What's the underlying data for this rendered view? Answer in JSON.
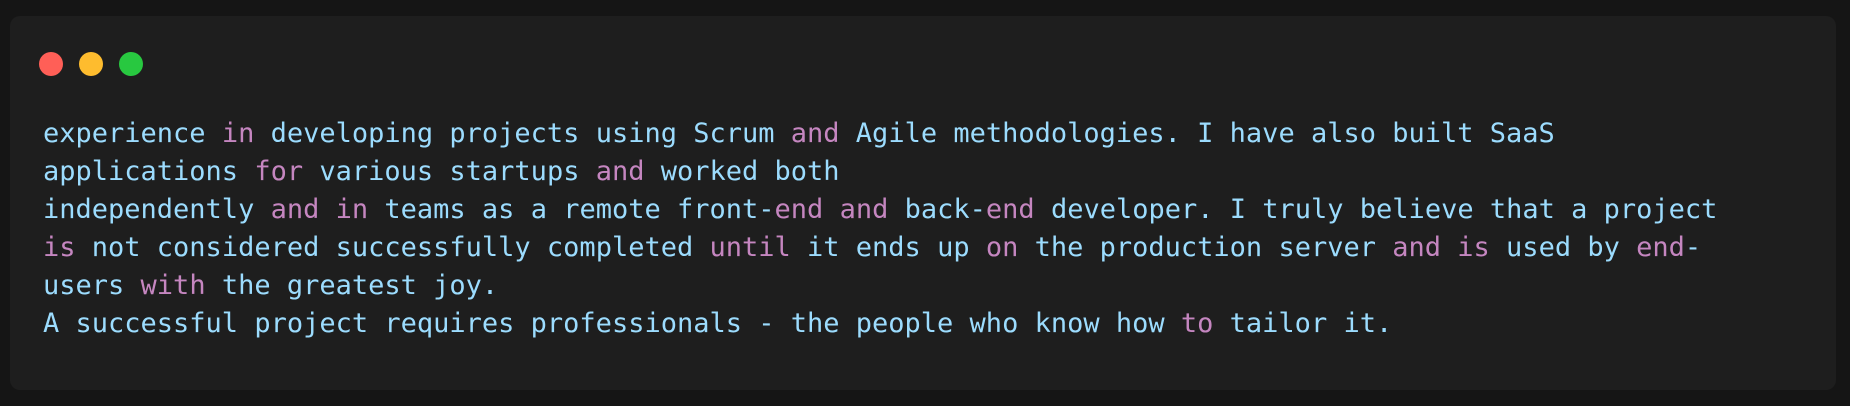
{
  "window": {
    "controls": [
      {
        "name": "close",
        "color": "#ff5f57"
      },
      {
        "name": "minimize",
        "color": "#febc2e"
      },
      {
        "name": "maximize",
        "color": "#28c840"
      }
    ]
  },
  "colors": {
    "text": "#9cdcfe",
    "keyword": "#c586c0",
    "background": "#1e1e1e"
  },
  "code": {
    "lines": [
      [
        {
          "t": "experience ",
          "k": 0
        },
        {
          "t": "in",
          "k": 1
        },
        {
          "t": " developing projects using Scrum ",
          "k": 0
        },
        {
          "t": "and",
          "k": 1
        },
        {
          "t": " Agile methodologies. I have also built SaaS",
          "k": 0
        }
      ],
      [
        {
          "t": "applications ",
          "k": 0
        },
        {
          "t": "for",
          "k": 1
        },
        {
          "t": " various startups ",
          "k": 0
        },
        {
          "t": "and",
          "k": 1
        },
        {
          "t": " worked both",
          "k": 0
        }
      ],
      [
        {
          "t": "independently ",
          "k": 0
        },
        {
          "t": "and",
          "k": 1
        },
        {
          "t": " ",
          "k": 0
        },
        {
          "t": "in",
          "k": 1
        },
        {
          "t": " teams as a remote front-",
          "k": 0
        },
        {
          "t": "end",
          "k": 1
        },
        {
          "t": " ",
          "k": 0
        },
        {
          "t": "and",
          "k": 1
        },
        {
          "t": " back-",
          "k": 0
        },
        {
          "t": "end",
          "k": 1
        },
        {
          "t": " developer. I truly believe that a project",
          "k": 0
        }
      ],
      [
        {
          "t": "is",
          "k": 1
        },
        {
          "t": " not considered successfully completed ",
          "k": 0
        },
        {
          "t": "until",
          "k": 1
        },
        {
          "t": " it ends up ",
          "k": 0
        },
        {
          "t": "on",
          "k": 1
        },
        {
          "t": " the production server ",
          "k": 0
        },
        {
          "t": "and",
          "k": 1
        },
        {
          "t": " ",
          "k": 0
        },
        {
          "t": "is",
          "k": 1
        },
        {
          "t": " used by ",
          "k": 0
        },
        {
          "t": "end",
          "k": 1
        },
        {
          "t": "-",
          "k": 0
        }
      ],
      [
        {
          "t": "users ",
          "k": 0
        },
        {
          "t": "with",
          "k": 1
        },
        {
          "t": " the greatest joy.",
          "k": 0
        }
      ],
      [
        {
          "t": "A successful project requires professionals - the people who know how ",
          "k": 0
        },
        {
          "t": "to",
          "k": 1
        },
        {
          "t": " tailor it.",
          "k": 0
        }
      ]
    ]
  }
}
